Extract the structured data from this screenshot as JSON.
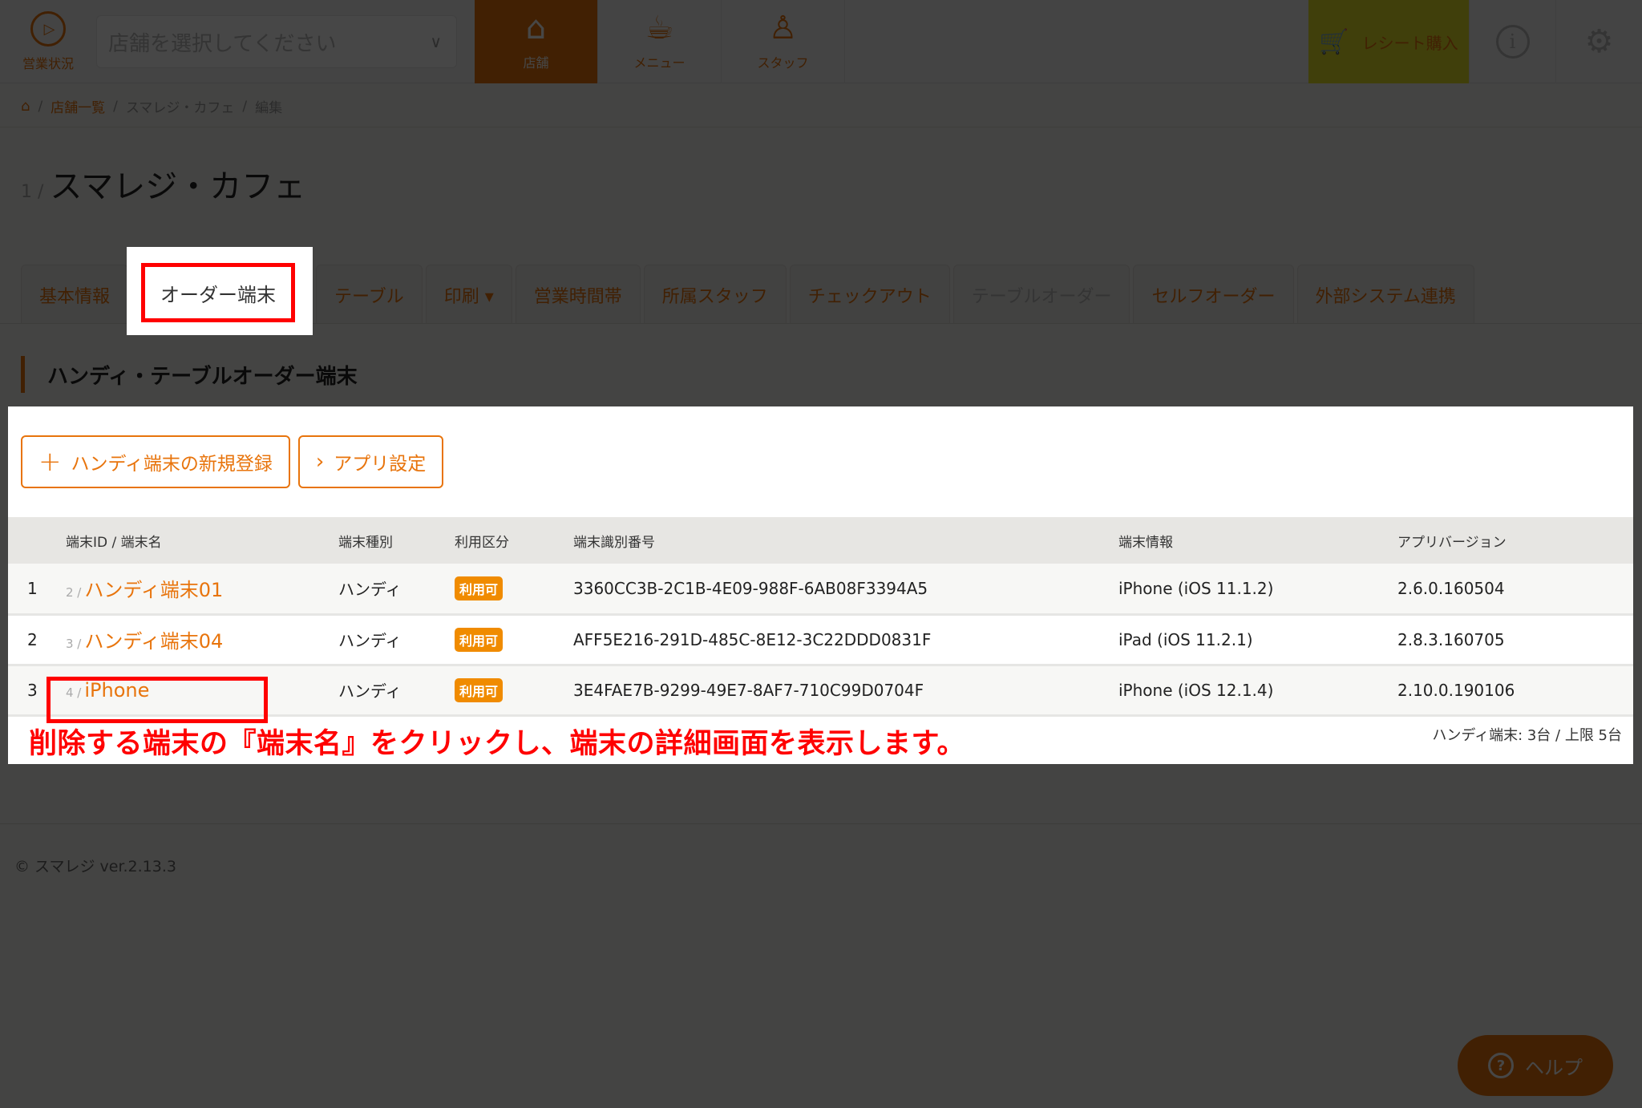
{
  "header": {
    "status_label": "営業状況",
    "store_select_placeholder": "店舗を選択してください",
    "nav": [
      {
        "label": "店舗",
        "icon": "store-icon",
        "active": true
      },
      {
        "label": "メニュー",
        "icon": "menu-cup-icon",
        "active": false
      },
      {
        "label": "スタッフ",
        "icon": "staff-icon",
        "active": false
      }
    ],
    "receipt_label": "レシート購入",
    "receipt_icon": "cart-icon",
    "info_icon": "info-icon",
    "settings_icon": "gear-icon"
  },
  "breadcrumb": {
    "home_icon": "home-icon",
    "items": [
      "店舗一覧",
      "スマレジ・カフェ",
      "編集"
    ],
    "separator": "/"
  },
  "page": {
    "store_id": "1 /",
    "store_name": "スマレジ・カフェ"
  },
  "tabs": [
    {
      "label": "基本情報",
      "state": "normal"
    },
    {
      "label": "オーダー端末",
      "state": "active"
    },
    {
      "label": "テーブル",
      "state": "normal"
    },
    {
      "label": "印刷 ▾",
      "state": "normal"
    },
    {
      "label": "営業時間帯",
      "state": "normal"
    },
    {
      "label": "所属スタッフ",
      "state": "normal"
    },
    {
      "label": "チェックアウト",
      "state": "normal"
    },
    {
      "label": "テーブルオーダー",
      "state": "disabled"
    },
    {
      "label": "セルフオーダー",
      "state": "normal"
    },
    {
      "label": "外部システム連携",
      "state": "normal"
    }
  ],
  "section": {
    "title": "ハンディ・テーブルオーダー端末",
    "buttons": {
      "register_label": "ハンディ端末の新規登録",
      "app_settings_label": "アプリ設定"
    }
  },
  "table": {
    "columns": [
      "",
      "端末ID / 端末名",
      "端末種別",
      "利用区分",
      "端末識別番号",
      "端末情報",
      "アプリバージョン"
    ],
    "rows": [
      {
        "index": "1",
        "id": "2 /",
        "name": "ハンディ端末01",
        "type": "ハンディ",
        "status": "利用可",
        "udid": "3360CC3B-2C1B-4E09-988F-6AB08F3394A5",
        "info": "iPhone (iOS 11.1.2)",
        "version": "2.6.0.160504"
      },
      {
        "index": "2",
        "id": "3 /",
        "name": "ハンディ端末04",
        "type": "ハンディ",
        "status": "利用可",
        "udid": "AFF5E216-291D-485C-8E12-3C22DDD0831F",
        "info": "iPad (iOS 11.2.1)",
        "version": "2.8.3.160705"
      },
      {
        "index": "3",
        "id": "4 /",
        "name": "iPhone",
        "type": "ハンディ",
        "status": "利用可",
        "udid": "3E4FAE7B-9299-49E7-8AF7-710C99D0704F",
        "info": "iPhone (iOS 12.1.4)",
        "version": "2.10.0.190106"
      }
    ],
    "count_note": "ハンディ端末: 3台 / 上限 5台"
  },
  "annotation": {
    "instruction": "削除する端末の『端末名』をクリックし、端末の詳細画面を表示します。"
  },
  "footer": {
    "copyright": "© スマレジ ver.2.13.3"
  },
  "help": {
    "label": "ヘルプ"
  },
  "colors": {
    "accent": "#e8740c",
    "badge": "#f08b00",
    "receipt_bg": "#e6e22a",
    "highlight": "#ff0000"
  }
}
